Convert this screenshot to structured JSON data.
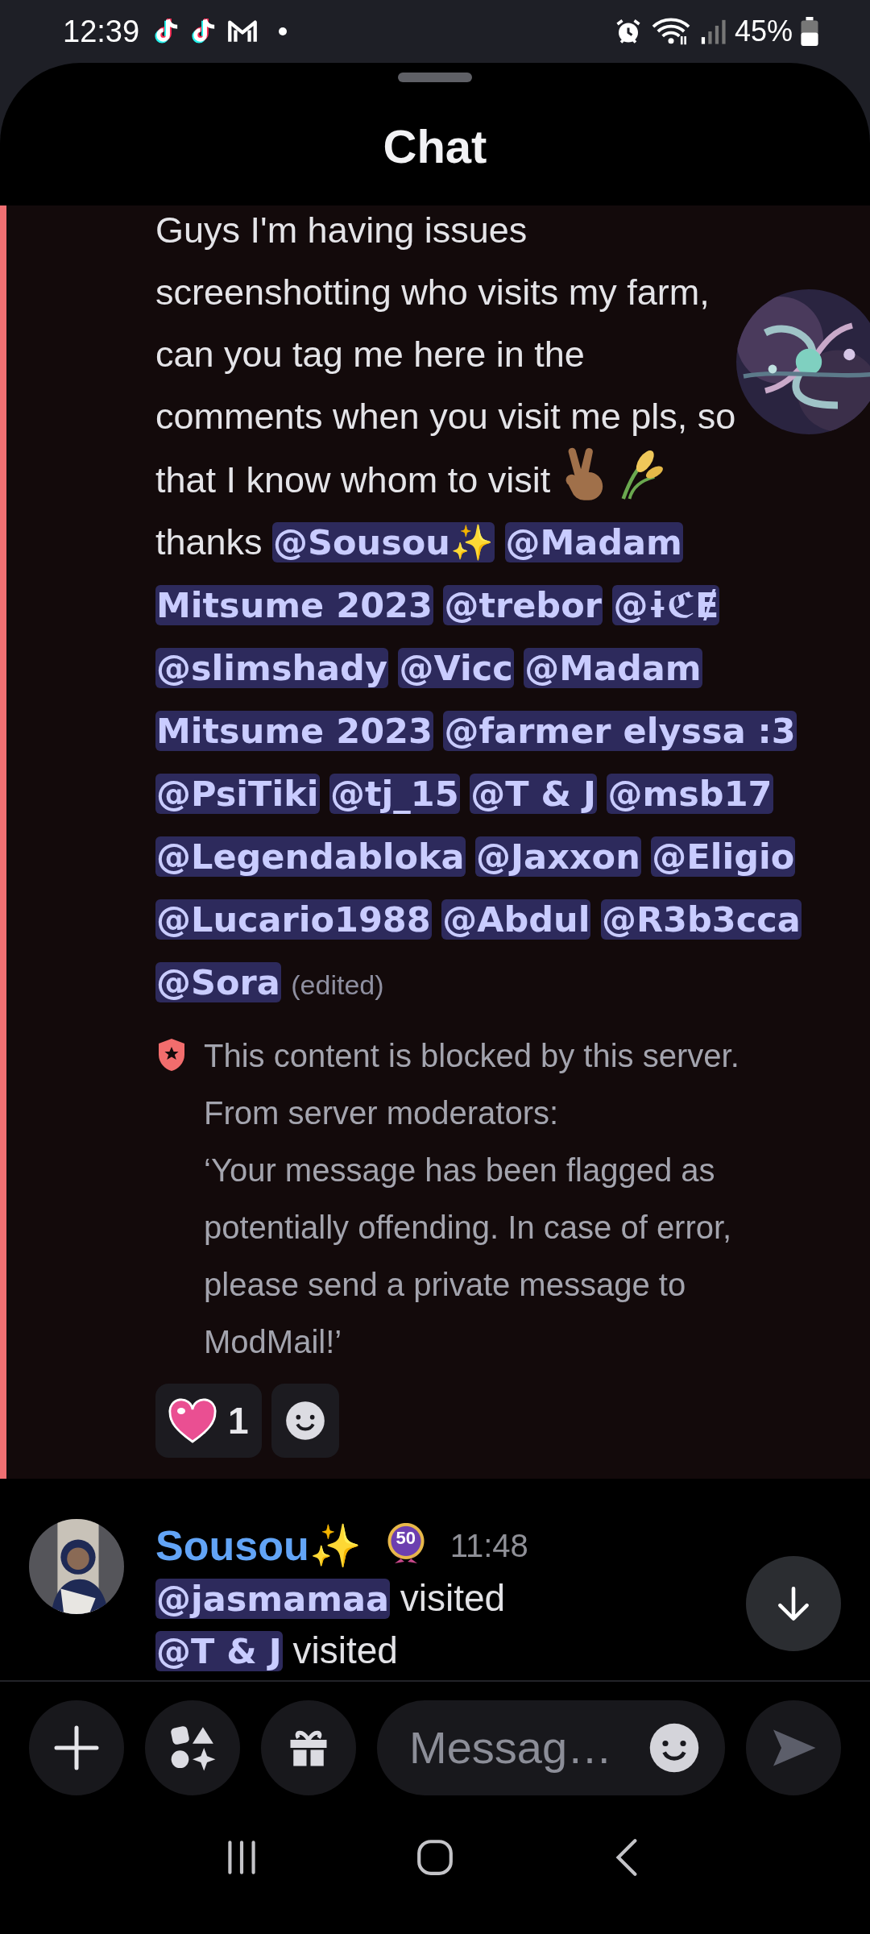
{
  "status_bar": {
    "time": "12:39",
    "battery": "45%"
  },
  "sheet": {
    "title": "Chat"
  },
  "flagged_message": {
    "lines": [
      [
        {
          "kind": "text",
          "text": "Guys I'm having issues"
        }
      ],
      [
        {
          "kind": "text",
          "text": "screenshotting who visits my farm,"
        }
      ],
      [
        {
          "kind": "text",
          "text": "can you tag me here in the"
        }
      ],
      [
        {
          "kind": "text",
          "text": "comments when you visit me pls, so"
        }
      ],
      [
        {
          "kind": "text",
          "text": "that I know whom to visit"
        },
        {
          "kind": "peace-hand"
        },
        {
          "kind": "wheat"
        }
      ],
      [
        {
          "kind": "text",
          "text": "thanks"
        },
        {
          "kind": "mention",
          "text": "@Sousou✨"
        },
        {
          "kind": "mention",
          "text": "@Madam"
        }
      ],
      [
        {
          "kind": "mention",
          "text": "Mitsume 2023"
        },
        {
          "kind": "mention",
          "text": "@trebor"
        },
        {
          "kind": "mention",
          "text": "@ɨℭɆ"
        }
      ],
      [
        {
          "kind": "mention",
          "text": "@slimshady"
        },
        {
          "kind": "mention",
          "text": "@Vicc"
        },
        {
          "kind": "mention",
          "text": "@Madam"
        }
      ],
      [
        {
          "kind": "mention",
          "text": "Mitsume 2023"
        },
        {
          "kind": "mention",
          "text": "@farmer elyssa :3"
        }
      ],
      [
        {
          "kind": "mention",
          "text": "@PsiTiki"
        },
        {
          "kind": "mention",
          "text": "@tj_15"
        },
        {
          "kind": "mention",
          "text": "@T & J"
        },
        {
          "kind": "mention",
          "text": "@msb17"
        }
      ],
      [
        {
          "kind": "mention",
          "text": "@Legendabloka"
        },
        {
          "kind": "mention",
          "text": "@Jaxxon"
        },
        {
          "kind": "mention",
          "text": "@Eligio"
        }
      ],
      [
        {
          "kind": "mention",
          "text": "@Lucario1988"
        },
        {
          "kind": "mention",
          "text": "@Abdul"
        },
        {
          "kind": "mention",
          "text": "@R3b3cca"
        }
      ],
      [
        {
          "kind": "mention",
          "text": "@Sora"
        },
        {
          "kind": "edited",
          "text": "(edited)"
        }
      ]
    ],
    "notice": {
      "title": "This content is blocked by this server.",
      "source": "From server moderators:",
      "text": "‘Your message has been flagged as potentially offending. In case of error, please send a private message to ModMail!’"
    },
    "reactions": [
      {
        "kind": "heart",
        "count": "1"
      },
      {
        "kind": "add"
      }
    ]
  },
  "message": {
    "author": "Sousou✨",
    "badge": "50",
    "time": "11:48",
    "lines": [
      [
        {
          "kind": "mention",
          "text": "@jasmamaa"
        },
        {
          "kind": "text",
          "text": "visited"
        }
      ],
      [
        {
          "kind": "mention",
          "text": "@T & J"
        },
        {
          "kind": "text",
          "text": "visited"
        }
      ]
    ]
  },
  "composer": {
    "placeholder": "Messag…"
  }
}
